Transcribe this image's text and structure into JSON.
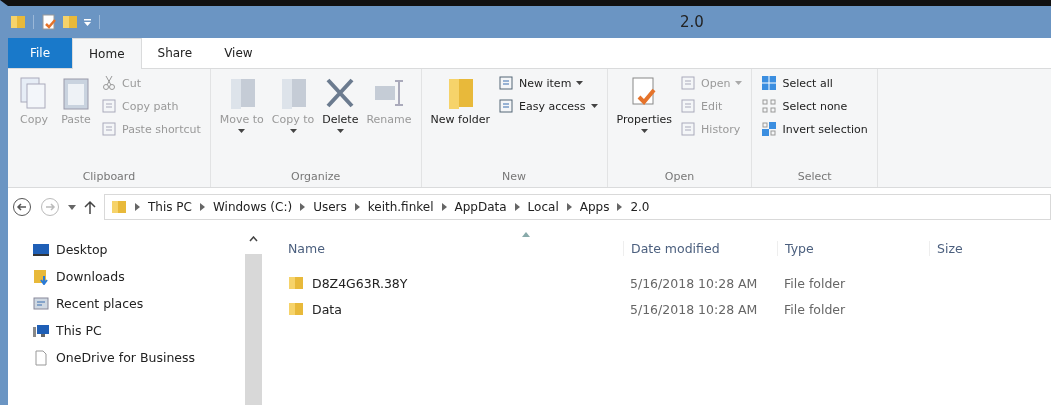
{
  "window": {
    "title": "2.0"
  },
  "tabs": [
    {
      "label": "File",
      "selected": false,
      "kind": "file"
    },
    {
      "label": "Home",
      "selected": true,
      "kind": "tab"
    },
    {
      "label": "Share",
      "selected": false,
      "kind": "tab"
    },
    {
      "label": "View",
      "selected": false,
      "kind": "tab"
    }
  ],
  "ribbon": [
    {
      "name": "Clipboard",
      "large": [
        {
          "label": "Copy",
          "disabled": true,
          "dropdown": false
        },
        {
          "label": "Paste",
          "disabled": true,
          "dropdown": false
        }
      ],
      "small": [
        {
          "label": "Cut",
          "disabled": true,
          "dropdown": false
        },
        {
          "label": "Copy path",
          "disabled": true,
          "dropdown": false
        },
        {
          "label": "Paste shortcut",
          "disabled": true,
          "dropdown": false
        }
      ]
    },
    {
      "name": "Organize",
      "large": [
        {
          "label": "Move to",
          "disabled": true,
          "dropdown": true
        },
        {
          "label": "Copy to",
          "disabled": true,
          "dropdown": true
        },
        {
          "label": "Delete",
          "disabled": false,
          "dropdown": true
        },
        {
          "label": "Rename",
          "disabled": true,
          "dropdown": false
        }
      ]
    },
    {
      "name": "New",
      "large": [
        {
          "label": "New folder",
          "disabled": false,
          "dropdown": false
        }
      ],
      "small": [
        {
          "label": "New item",
          "disabled": false,
          "dropdown": true
        },
        {
          "label": "Easy access",
          "disabled": false,
          "dropdown": true
        }
      ]
    },
    {
      "name": "Open",
      "large": [
        {
          "label": "Properties",
          "disabled": false,
          "dropdown": true
        }
      ],
      "small": [
        {
          "label": "Open",
          "disabled": true,
          "dropdown": true
        },
        {
          "label": "Edit",
          "disabled": true,
          "dropdown": false
        },
        {
          "label": "History",
          "disabled": true,
          "dropdown": false
        }
      ]
    },
    {
      "name": "Select",
      "small": [
        {
          "label": "Select all",
          "disabled": false,
          "dropdown": false
        },
        {
          "label": "Select none",
          "disabled": false,
          "dropdown": false
        },
        {
          "label": "Invert selection",
          "disabled": false,
          "dropdown": false
        }
      ]
    }
  ],
  "address": {
    "back_disabled": false,
    "forward_disabled": true,
    "path": [
      "This PC",
      "Windows (C:)",
      "Users",
      "keith.finkel",
      "AppData",
      "Local",
      "Apps",
      "2.0"
    ]
  },
  "sidebar": {
    "items": [
      {
        "label": "Desktop"
      },
      {
        "label": "Downloads"
      },
      {
        "label": "Recent places"
      },
      {
        "label": "This PC"
      },
      {
        "label": "OneDrive for Business"
      }
    ]
  },
  "table": {
    "columns": [
      "Name",
      "Date modified",
      "Type",
      "Size"
    ],
    "rows": [
      [
        "D8Z4G63R.38Y",
        "5/16/2018 10:28 AM",
        "File folder"
      ],
      [
        "Data",
        "5/16/2018 10:28 AM",
        "File folder"
      ]
    ]
  }
}
